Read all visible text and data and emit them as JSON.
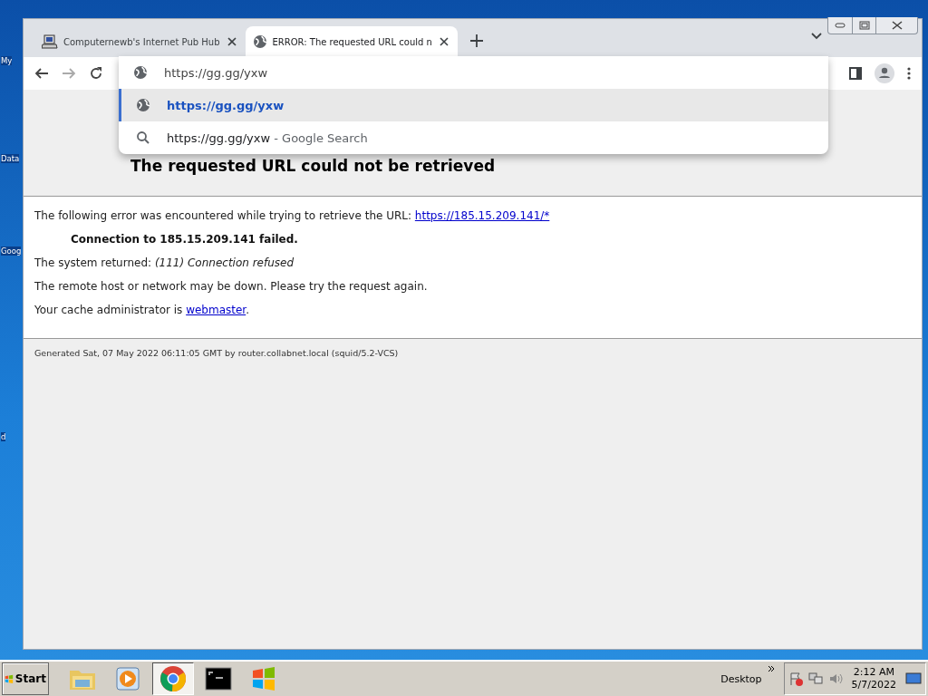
{
  "desktop_icons": [
    {
      "label": "My"
    },
    {
      "label": "Data"
    },
    {
      "label": "Goog"
    },
    {
      "label": "d"
    }
  ],
  "tabs": [
    {
      "title": "Computernewb's Internet Pub Hub",
      "selected": false
    },
    {
      "title": "ERROR: The requested URL could n",
      "selected": true
    }
  ],
  "address_bar": {
    "value": "https://gg.gg/yxw"
  },
  "suggestions": [
    {
      "kind": "url",
      "text": "https://gg.gg/yxw",
      "selected": true
    },
    {
      "kind": "search",
      "text": "https://gg.gg/yxw",
      "suffix": " - Google Search",
      "selected": false
    }
  ],
  "page": {
    "heading": "The requested URL could not be retrieved",
    "intro": "The following error was encountered while trying to retrieve the URL: ",
    "url_link": "https://185.15.209.141/*",
    "failure": "Connection to 185.15.209.141 failed.",
    "system_returned": "The system returned: *(111) Connection refused*",
    "advice": "The remote host or network may be down. Please try the request again.",
    "admin": "Your cache administrator is ",
    "admin_link": "webmaster",
    "admin_end": ".",
    "footer": "Generated Sat, 07 May 2022 06:11:05 GMT by router.collabnet.local (squid/5.2-VCS)"
  },
  "taskbar": {
    "start": "Start",
    "apps": [
      {
        "kind": "folder",
        "selected": false
      },
      {
        "kind": "media",
        "selected": false
      },
      {
        "kind": "chrome",
        "selected": true
      },
      {
        "kind": "terminal",
        "selected": false
      },
      {
        "kind": "windows",
        "selected": false
      }
    ],
    "desktop": "Desktop",
    "time": "2:12 AM",
    "date": "5/7/2022"
  }
}
